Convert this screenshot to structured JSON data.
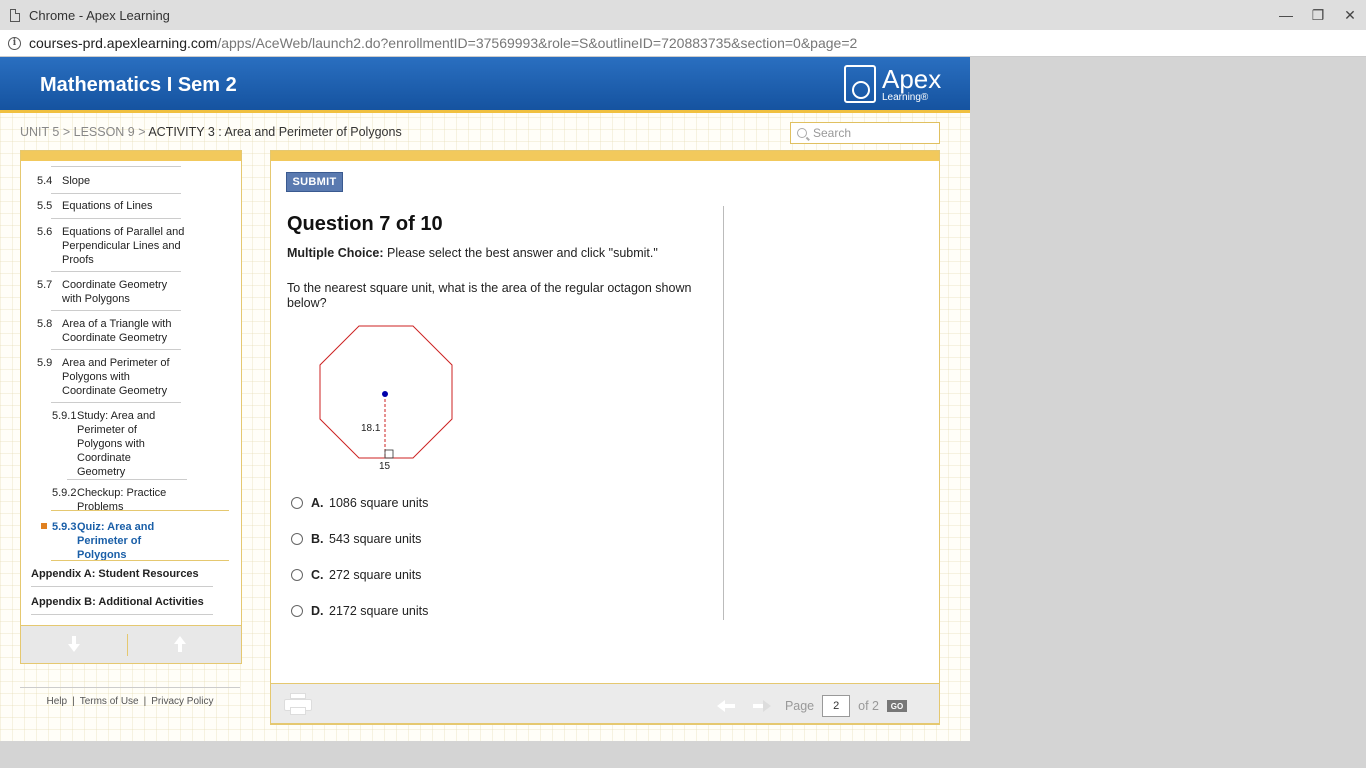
{
  "window": {
    "title": "Chrome - Apex Learning",
    "minimize": "—",
    "restore": "❐",
    "close": "✕"
  },
  "address_bar": {
    "host": "courses-prd.apexlearning.com",
    "path": "/apps/AceWeb/launch2.do?enrollmentID=37569993&role=S&outlineID=720883735&section=0&page=2",
    "info": "i"
  },
  "header": {
    "course_title": "Mathematics I Sem 2",
    "logo_name": "Apex",
    "logo_sub": "Learning®"
  },
  "breadcrumb": {
    "unit": "UNIT 5",
    "sep1": " > ",
    "lesson": "LESSON 9",
    "sep2": " > ",
    "activity": "ACTIVITY 3 : Area and Perimeter of Polygons"
  },
  "search": {
    "placeholder": "Search"
  },
  "sidebar": {
    "items": [
      {
        "num": "5.4",
        "label": "Slope"
      },
      {
        "num": "5.5",
        "label": "Equations of Lines"
      },
      {
        "num": "5.6",
        "label": "Equations of Parallel and Perpendicular Lines and Proofs"
      },
      {
        "num": "5.7",
        "label": "Coordinate Geometry with Polygons"
      },
      {
        "num": "5.8",
        "label": "Area of a Triangle with Coordinate Geometry"
      },
      {
        "num": "5.9",
        "label": "Area and Perimeter of Polygons with Coordinate Geometry"
      },
      {
        "num": "5.9.1",
        "label": "Study: Area and Perimeter of Polygons with Coordinate Geometry"
      },
      {
        "num": "5.9.2",
        "label": "Checkup: Practice Problems"
      },
      {
        "num": "5.9.3",
        "label": "Quiz: Area and Perimeter of Polygons"
      }
    ],
    "appendix_a": "Appendix A: Student Resources",
    "appendix_b": "Appendix B: Additional Activities"
  },
  "footer_links": {
    "help": "Help",
    "terms": "Terms of Use",
    "privacy": "Privacy Policy",
    "sep": "|"
  },
  "question": {
    "submit_label": "SUBMIT",
    "title": "Question 7 of 10",
    "instr_bold": "Multiple Choice:",
    "instr_text": " Please select the best answer and click \"submit.\"",
    "text": "To the nearest square unit, what is the area of the regular octagon shown below?",
    "figure": {
      "apothem_label": "18.1",
      "side_label": "15"
    },
    "choices": [
      {
        "letter": "A.",
        "text": "1086 square units"
      },
      {
        "letter": "B.",
        "text": "543 square units"
      },
      {
        "letter": "C.",
        "text": "272 square units"
      },
      {
        "letter": "D.",
        "text": "2172 square units"
      }
    ]
  },
  "pager": {
    "page_label": "Page",
    "page_value": "2",
    "of_label": "of 2",
    "go_label": "GO"
  },
  "colors": {
    "header_blue": "#1553a0",
    "accent_gold": "#f2c95c",
    "octagon_stroke": "#cc2222",
    "active_link": "#1a5fa8"
  }
}
